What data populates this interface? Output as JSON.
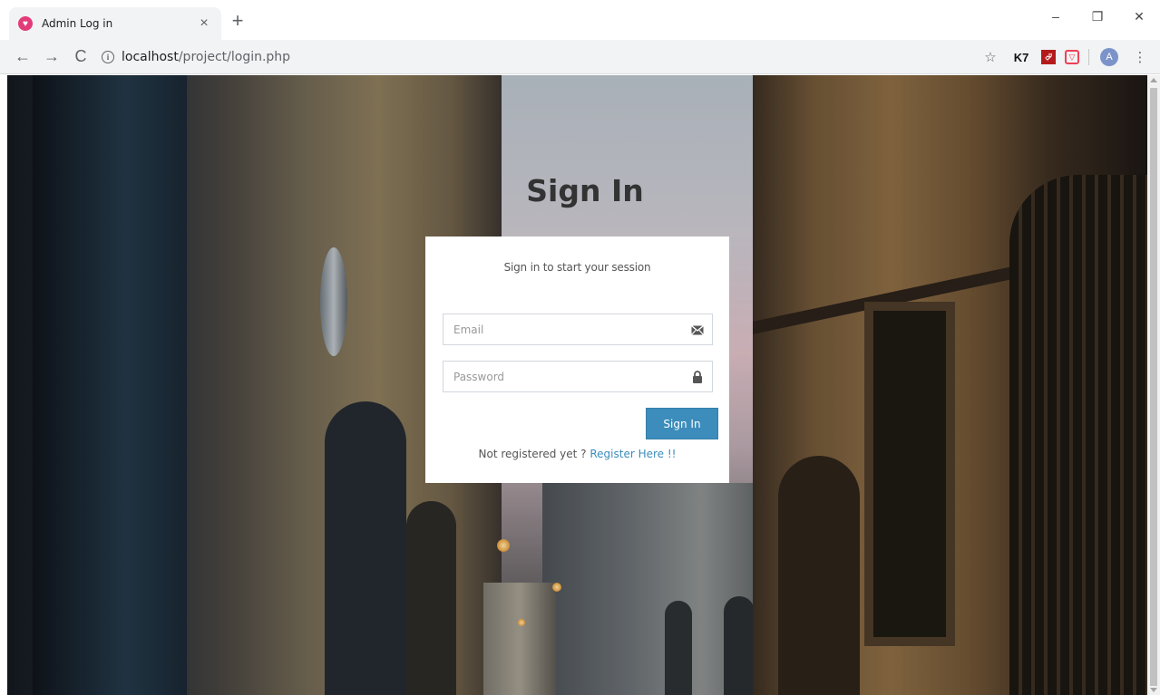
{
  "browser": {
    "tab": {
      "title": "Admin Log in",
      "favicon_glyph": "♥",
      "close_glyph": "×"
    },
    "new_tab_glyph": "+",
    "window_controls": {
      "minimize": "–",
      "restore": "❐",
      "close": "✕"
    },
    "nav": {
      "back": "←",
      "forward": "→",
      "reload": "C"
    },
    "address": {
      "info_glyph": "i",
      "host": "localhost",
      "path": "/project/login.php"
    },
    "extensions": {
      "bookmark_glyph": "☆",
      "k7_label": "K7",
      "pdf_label": "⮰",
      "pocket_label": "▽",
      "avatar_initial": "A",
      "menu_glyph": "⋮"
    }
  },
  "login": {
    "title": "Sign In",
    "message": "Sign in to start your session",
    "email_placeholder": "Email",
    "password_placeholder": "Password",
    "submit_label": "Sign In",
    "register_prompt": "Not registered yet ? ",
    "register_link": "Register Here !!"
  },
  "colors": {
    "primary": "#3c8dbc",
    "favicon": "#e33b7a",
    "title_text": "#333333"
  }
}
